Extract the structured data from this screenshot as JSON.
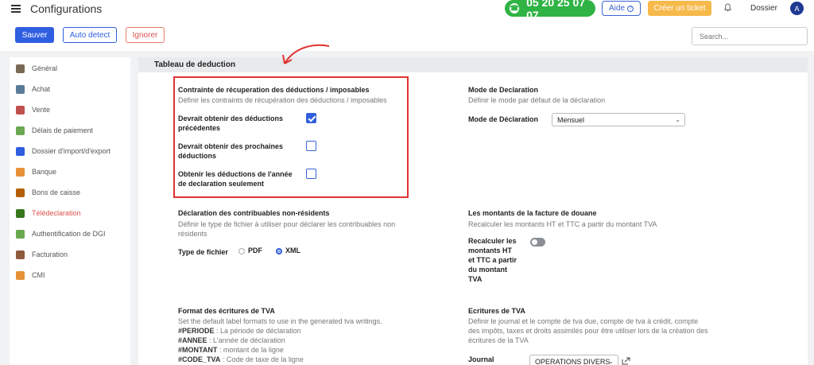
{
  "header": {
    "title": "Configurations",
    "phone": "05 20 25 07 07",
    "help_label": "Aide",
    "ticket_label": "Créer un ticket",
    "dossier_label": "Dossier",
    "avatar_initial": "A"
  },
  "toolbar": {
    "save_label": "Sauver",
    "auto_detect_label": "Auto detect",
    "ignore_label": "Ignorer",
    "search_placeholder": "Search..."
  },
  "sidebar": {
    "items": [
      {
        "label": "Général",
        "icon": "gear-icon",
        "color": "#7a6a55"
      },
      {
        "label": "Achat",
        "icon": "cart-icon",
        "color": "#5a7a9a"
      },
      {
        "label": "Vente",
        "icon": "chart-icon",
        "color": "#c0504d"
      },
      {
        "label": "Délais de paiement",
        "icon": "calendar-icon",
        "color": "#6aa84f"
      },
      {
        "label": "Dossier d'import/d'export",
        "icon": "folder-icon",
        "color": "#2f5ee0"
      },
      {
        "label": "Banque",
        "icon": "bank-icon",
        "color": "#e69138"
      },
      {
        "label": "Bons de caisse",
        "icon": "receipt-icon",
        "color": "#b45f06"
      },
      {
        "label": "Télédeclaration",
        "icon": "document-icon",
        "color": "#38761d"
      },
      {
        "label": "Authentification de DGI",
        "icon": "key-icon",
        "color": "#6aa84f"
      },
      {
        "label": "Facturation",
        "icon": "tag-icon",
        "color": "#8e5a3c"
      },
      {
        "label": "CMI",
        "icon": "card-icon",
        "color": "#e69138"
      }
    ],
    "active_index": 7
  },
  "main": {
    "section_title": "Tableau de deduction",
    "contraintes": {
      "title": "Contrainte de récuperation des déductions / imposables",
      "desc": "Définir les contraints de récupération des déductions / imposables",
      "fields": [
        {
          "label_line1": "Devrait obtenir des déductions",
          "label_line2": "précédentes",
          "checked": true
        },
        {
          "label_line1": "Devrait obtenir des prochaines",
          "label_line2": "déductions",
          "checked": false
        },
        {
          "label_line1": "Obtenir les déductions de l'année",
          "label_line2": "de declaration seulement",
          "checked": false
        }
      ]
    },
    "mode_declaration": {
      "title": "Mode de Declaration",
      "desc": "Définir le mode par défaut de la déclaration",
      "field_label": "Mode de Déclaration",
      "selected": "Mensuel"
    },
    "non_residents": {
      "title": "Déclaration des contribuables non-résidents",
      "desc_line1": "Définir le type de fichier à utiliser pour déclarer les contribuables non",
      "desc_line2": "résidents",
      "field_label": "Type de fichier",
      "option_pdf": "PDF",
      "option_xml": "XML",
      "selected": "XML"
    },
    "douane": {
      "title": "Les montants de la facture de douane",
      "desc": "Recalculer les montants HT et TTC a partir du montant TVA",
      "field_lines": [
        "Recalculer les",
        "montants HT",
        "et TTC a partir",
        "du montant",
        "TVA"
      ],
      "toggle_on": false
    },
    "format_tva": {
      "title": "Format des écritures de TVA",
      "desc": "Set the default label formats to use in the generated tva writings.",
      "tokens": [
        {
          "key": "#PERIODE",
          "text": " : La période de déclaration"
        },
        {
          "key": "#ANNEE",
          "text": " : L'année de déclaration"
        },
        {
          "key": "#MONTANT",
          "text": " : montant de la ligne"
        },
        {
          "key": "#CODE_TVA",
          "text": " : Code de taxe de la ligne"
        }
      ]
    },
    "ecritures_tva": {
      "title": "Ecritures de TVA",
      "desc_lines": [
        "Définir le journal et le compte de tva due, compte de tva à crédit, compte",
        "des impôts, taxes et droits assimilés pour être utiliser lors de la création des",
        "écritures de la TVA"
      ],
      "journal_label": "Journal",
      "journal_value": "OPERATIONS DIVERS"
    }
  },
  "colors": {
    "primary": "#2f5ee0",
    "success": "#2fb344",
    "warning": "#f6b94a",
    "danger": "#d9534f",
    "highlight": "#e03131"
  }
}
